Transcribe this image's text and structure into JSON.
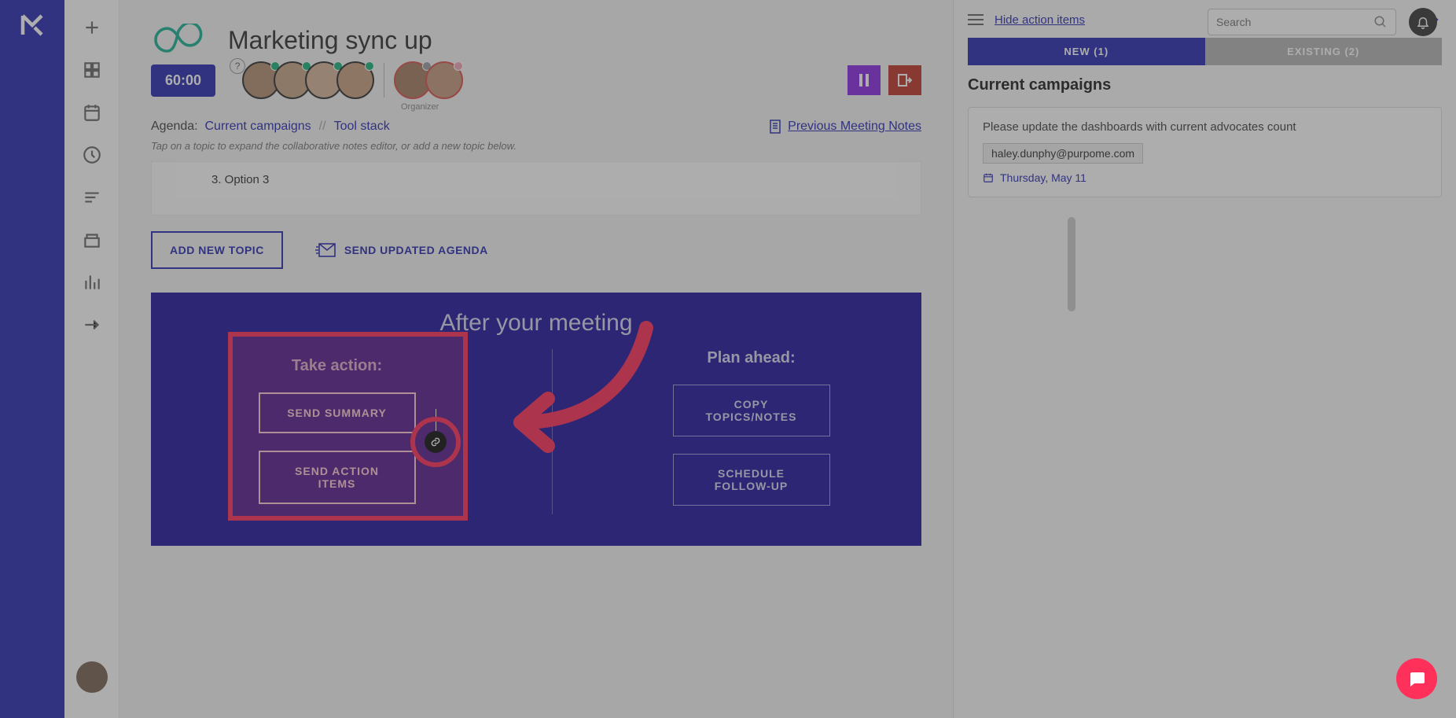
{
  "search": {
    "placeholder": "Search"
  },
  "header": {
    "title": "Marketing sync up",
    "timer": "60:00",
    "organizer_label": "Organizer",
    "agenda_label": "Agenda:",
    "agenda_items": [
      "Current campaigns",
      "Tool stack"
    ],
    "previous_notes": "Previous Meeting Notes",
    "hint": "Tap on a topic to expand the collaborative notes editor, or add a new topic below."
  },
  "notes": {
    "option3": "3. Option 3"
  },
  "topic_actions": {
    "add_topic": "ADD NEW TOPIC",
    "send_agenda": "SEND UPDATED AGENDA"
  },
  "after": {
    "title": "After your meeting",
    "take_action": "Take action:",
    "plan_ahead": "Plan ahead:",
    "send_summary": "SEND SUMMARY",
    "send_action_items": "SEND ACTION ITEMS",
    "copy_topics": "COPY TOPICS/NOTES",
    "schedule_followup": "SCHEDULE FOLLOW-UP"
  },
  "right": {
    "hide": "Hide action items",
    "tabs": {
      "new": "NEW (1)",
      "existing": "EXISTING (2)"
    },
    "section_title": "Current campaigns",
    "card": {
      "desc": "Please update the dashboards with current advocates count",
      "email": "haley.dunphy@purpome.com",
      "date": "Thursday, May 11"
    }
  }
}
